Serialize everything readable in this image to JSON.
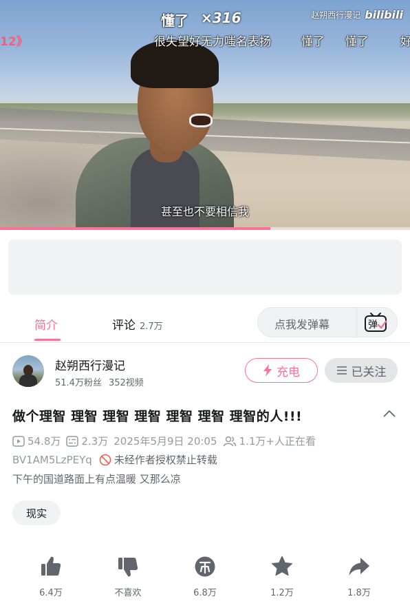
{
  "video": {
    "danmaku": {
      "combo_text": "懂了",
      "combo_count": "×316",
      "line2": "很失望好无力嗤名表扬",
      "line2b": "懂了",
      "line2c": "懂了",
      "line2d": "好",
      "left_tag": "12》"
    },
    "watermark": {
      "uploader": "赵朔西行漫记",
      "logo": "bilibili"
    },
    "subtitle": "甚至也不要相信我",
    "progress": 0.66
  },
  "tabs": {
    "intro": "简介",
    "comments": "评论",
    "comments_count": "2.7万",
    "danmaku_placeholder": "点我发弹幕",
    "danmaku_icon_label": "弹"
  },
  "uploader": {
    "name": "赵朔西行漫记",
    "fans": "51.4万粉丝",
    "videos": "352视频",
    "charge_label": "充电",
    "follow_label": "已关注"
  },
  "video_info": {
    "title": "做个理智 理智 理智 理智 理智 理智 理智的人!!!",
    "views": "54.8万",
    "danmaku_count": "2.3万",
    "date": "2025年5月9日 20:05",
    "watching": "1.1万+人正在看",
    "bvid": "BV1AM5LzPEYq",
    "no_repost": "未经作者授权禁止转载",
    "description": "下午的国道路面上有点温暖 又那么凉",
    "tags": [
      "现实"
    ]
  },
  "actions": {
    "like": "6.4万",
    "dislike": "不喜欢",
    "coin": "6.8万",
    "favorite": "1.2万",
    "share": "1.8万"
  },
  "colors": {
    "accent": "#fb7299",
    "text": "#18191c",
    "muted": "#9499a0"
  }
}
